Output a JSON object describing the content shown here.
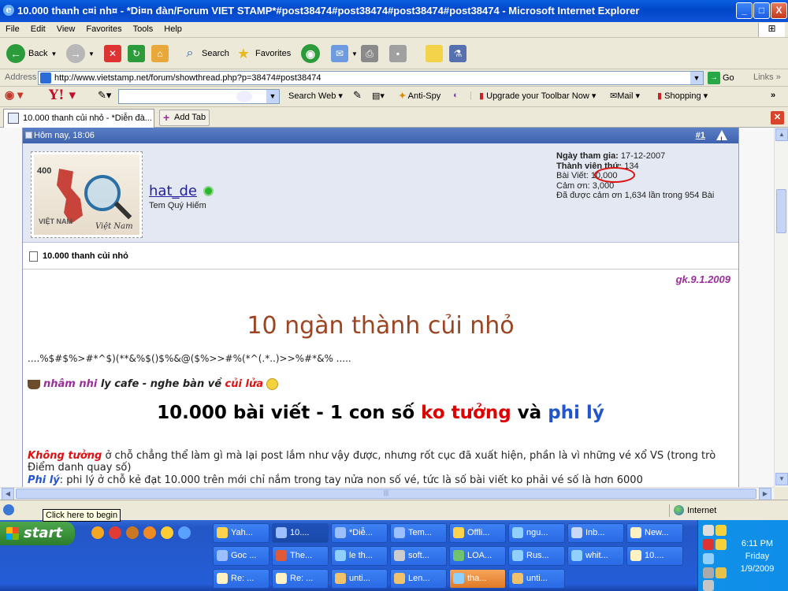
{
  "window": {
    "title": "10.000 thanh c¤i nh¤ - *Di¤n đàn/Forum VIET STAMP*#post38474#post38474#post38474#post38474 - Microsoft Internet Explorer",
    "controls": [
      "_",
      "□",
      "X"
    ]
  },
  "menu": [
    "File",
    "Edit",
    "View",
    "Favorites",
    "Tools",
    "Help"
  ],
  "toolbar": {
    "back": "Back",
    "search": "Search",
    "favorites": "Favorites"
  },
  "address": {
    "label": "Address",
    "url": "http://www.vietstamp.net/forum/showthread.php?p=38474#post38474",
    "go": "Go",
    "links": "Links"
  },
  "yahoo_toolbar": {
    "search_web": "Search Web",
    "anti_spy": "Anti-Spy",
    "upgrade": "Upgrade your Toolbar Now",
    "mail": "Mail",
    "shopping": "Shopping"
  },
  "tabs": {
    "active": "10.000 thanh củi nhỏ - *Diễn đà...",
    "add": "Add Tab"
  },
  "post": {
    "date": "Hôm nay, 18:06",
    "number": "#1",
    "username": "hat_de",
    "user_title": "Tem Quý Hiếm",
    "stamp_value": "400",
    "stamp_country": "VIỆT NAM",
    "stamp_script": "Việt Nam",
    "stats": [
      {
        "label": "Ngày tham gia:",
        "value": "17-12-2007"
      },
      {
        "label": "Thành viên thứ:",
        "value": "134"
      },
      {
        "label": "Bài Viết:",
        "value": "10,000"
      },
      {
        "label": "Cảm ơn:",
        "value": "3,000"
      },
      {
        "label": "Đã được cảm ơn 1,634 lần trong 954 Bài",
        "value": ""
      }
    ],
    "thread_title": "10.000 thanh củi nhỏ",
    "signature_date": "gk.9.1.2009",
    "big_title": "10 ngàn thành củi nhỏ",
    "symbols": "....%$#$%>#*^$)(**&%$()$%&@($%>>#%(*^(.*..)>>%#*&% .....",
    "cafe": {
      "part1": "nhâm nhi",
      "part2": " ly cafe - nghe bàn về ",
      "part3": "củi lửa"
    },
    "headline": {
      "part1": "10.000 bài viết - 1 con số ",
      "part2": "ko tưởng",
      "part3": " và ",
      "part4": "phi lý"
    },
    "para1": {
      "lead": "Không tưởng",
      "text": " ở chỗ chẳng thể làm gì mà lại post lắm như vậy được, nhưng rốt cục đã xuất hiện, phần là vì những vé xổ VS (trong trò Điểm danh quay số)"
    },
    "para2": {
      "lead": "Phi lý",
      "text": ": phi lý ở chỗ kẻ đạt 10.000 trên mới chỉ nắm trong tay nửa non số vé, tức là số bài viết ko phải vé số là hơn 6000"
    }
  },
  "statusbar": {
    "tooltip": "Click here to begin",
    "zone": "Internet"
  },
  "taskbar": {
    "start": "start",
    "row1": [
      "Yah...",
      "10....",
      "*Diễ...",
      "Tem...",
      "Offli...",
      "ngu...",
      "Inb...",
      "New..."
    ],
    "row2": [
      "Goc ...",
      "The...",
      "le th...",
      "soft...",
      "LOA...",
      "Rus...",
      "whit...",
      "10...."
    ],
    "row3": [
      "Re: ...",
      "Re: ...",
      "unti...",
      "Len...",
      "tha...",
      "unti..."
    ],
    "clock": {
      "time": "6:11 PM",
      "day": "Friday",
      "date": "1/9/2009"
    }
  },
  "colors": {
    "accent_red": "#dd0000",
    "accent_blue": "#2255cc",
    "purple": "#9b2d9b",
    "brown_title": "#9b4522"
  }
}
